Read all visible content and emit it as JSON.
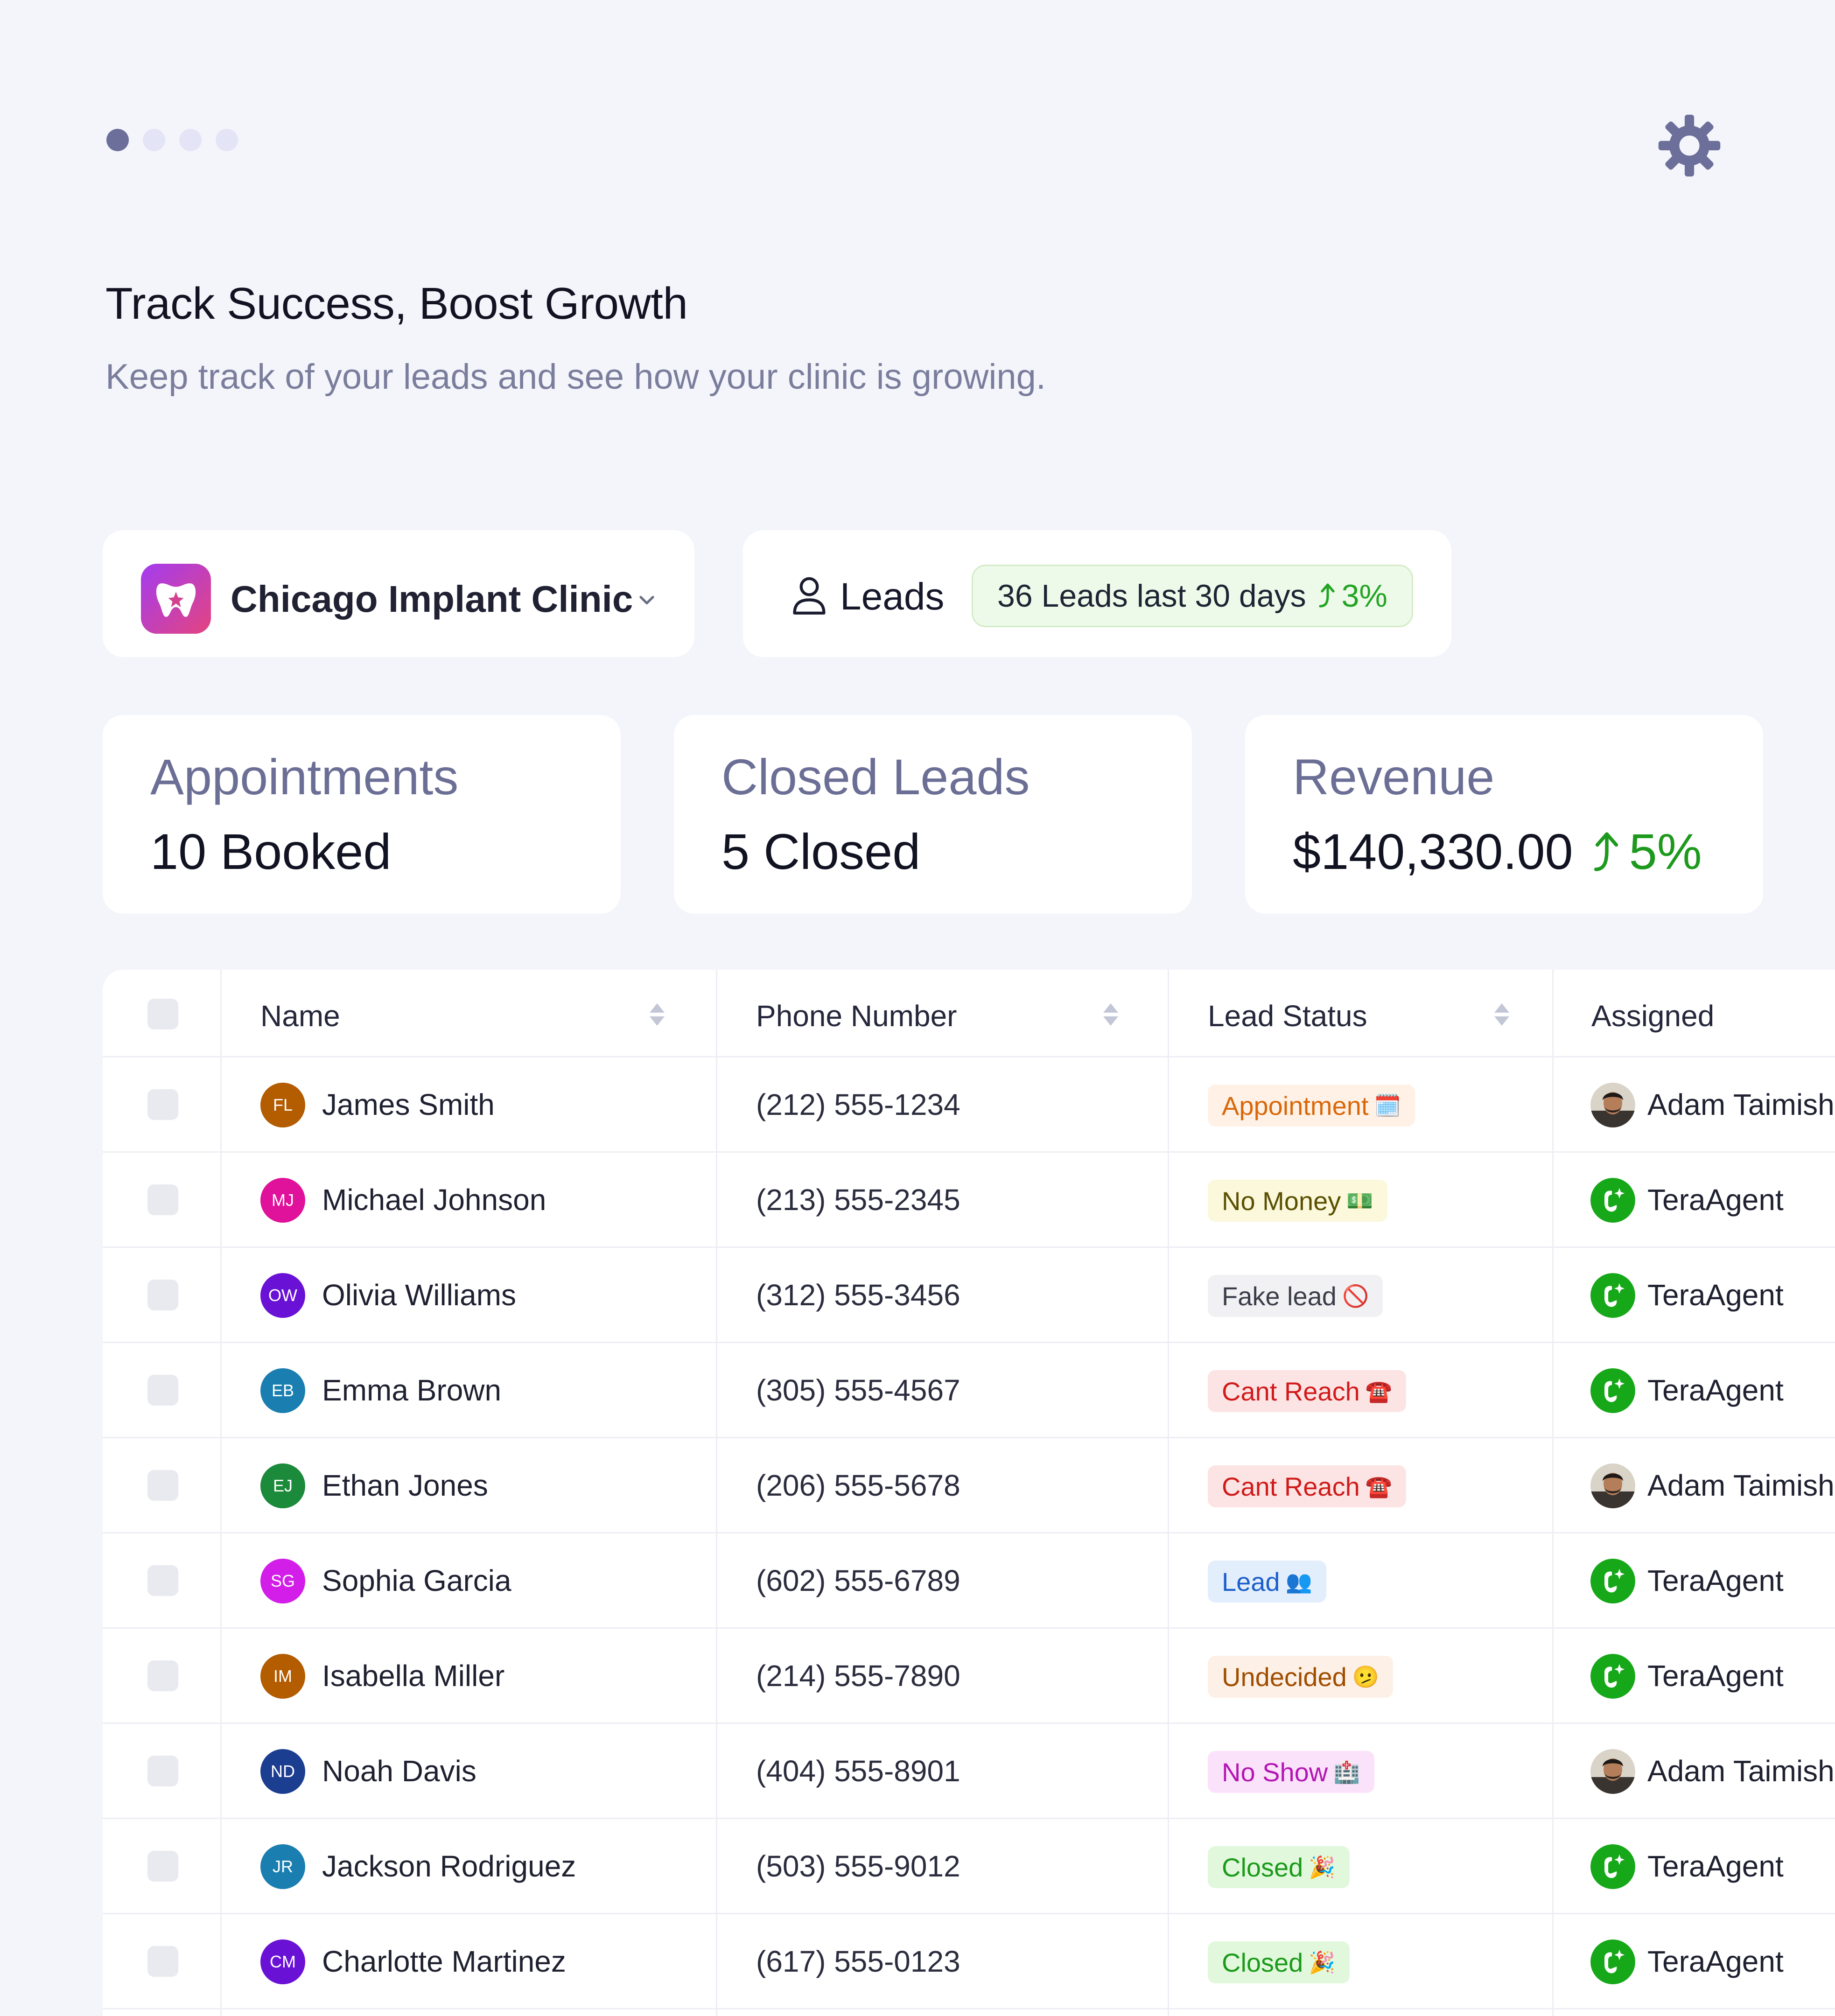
{
  "pager": {
    "dots": 4,
    "active": 0
  },
  "header": {
    "title": "Track Success, Boost Growth",
    "subtitle": "Keep track of your leads and see how your clinic is growing."
  },
  "clinic": {
    "name": "Chicago Implant Clinic"
  },
  "leads": {
    "label": "Leads",
    "summary": "36 Leads last 30 days",
    "change": "3%"
  },
  "stats": [
    {
      "label": "Appointments",
      "value": "10 Booked"
    },
    {
      "label": "Closed Leads",
      "value": "5 Closed"
    },
    {
      "label": "Revenue",
      "value": "$140,330.00",
      "change": "5%"
    }
  ],
  "table": {
    "columns": [
      "Name",
      "Phone Number",
      "Lead Status",
      "Assigned"
    ],
    "rows": [
      {
        "initials": "FL",
        "name": "James Smith",
        "phone": "(212) 555-1234",
        "status": "Appointment",
        "status_icon": "🗓️",
        "status_type": "appointment",
        "assigned": "Adam Taimish",
        "assigned_type": "person"
      },
      {
        "initials": "MJ",
        "name": "Michael Johnson",
        "phone": "(213) 555-2345",
        "status": "No Money",
        "status_icon": "💵",
        "status_type": "nomoney",
        "assigned": "TeraAgent",
        "assigned_type": "agent"
      },
      {
        "initials": "OW",
        "name": "Olivia Williams",
        "phone": "(312) 555-3456",
        "status": "Fake lead",
        "status_icon": "🚫",
        "status_type": "fake",
        "assigned": "TeraAgent",
        "assigned_type": "agent"
      },
      {
        "initials": "EB",
        "name": "Emma Brown",
        "phone": "(305) 555-4567",
        "status": "Cant Reach",
        "status_icon": "☎️",
        "status_type": "cantreach",
        "assigned": "TeraAgent",
        "assigned_type": "agent"
      },
      {
        "initials": "EJ",
        "name": "Ethan Jones",
        "phone": "(206) 555-5678",
        "status": "Cant Reach",
        "status_icon": "☎️",
        "status_type": "cantreach",
        "assigned": "Adam Taimish",
        "assigned_type": "person"
      },
      {
        "initials": "SG",
        "name": "Sophia Garcia",
        "phone": "(602) 555-6789",
        "status": "Lead",
        "status_icon": "👥",
        "status_type": "lead",
        "assigned": "TeraAgent",
        "assigned_type": "agent"
      },
      {
        "initials": "IM",
        "name": "Isabella Miller",
        "phone": "(214) 555-7890",
        "status": "Undecided",
        "status_icon": "🫤",
        "status_type": "undecided",
        "assigned": "TeraAgent",
        "assigned_type": "agent"
      },
      {
        "initials": "ND",
        "name": "Noah Davis",
        "phone": "(404) 555-8901",
        "status": "No Show",
        "status_icon": "🏥",
        "status_type": "noshow",
        "assigned": "Adam Taimish",
        "assigned_type": "person"
      },
      {
        "initials": "JR",
        "name": "Jackson Rodriguez",
        "phone": "(503) 555-9012",
        "status": "Closed",
        "status_icon": "🎉",
        "status_type": "closed",
        "assigned": "TeraAgent",
        "assigned_type": "agent"
      },
      {
        "initials": "CM",
        "name": "Charlotte Martinez",
        "phone": "(617) 555-0123",
        "status": "Closed",
        "status_icon": "🎉",
        "status_type": "closed",
        "assigned": "TeraAgent",
        "assigned_type": "agent"
      }
    ]
  },
  "colors": {
    "avatars": [
      "#b35c00",
      "#e0119a",
      "#6a11d6",
      "#1a7fb0",
      "#1b8a3a",
      "#d21ee8",
      "#b35c00",
      "#1c3e91",
      "#1a7fb0",
      "#6a11d6"
    ],
    "status": {
      "appointment": {
        "bg": "#fff1e6",
        "fg": "#d9680a"
      },
      "nomoney": {
        "bg": "#fbf8dc",
        "fg": "#5a5000"
      },
      "fake": {
        "bg": "#f1f1f3",
        "fg": "#3b3d4a"
      },
      "cantreach": {
        "bg": "#fde4e4",
        "fg": "#d11a1a"
      },
      "lead": {
        "bg": "#e3eefd",
        "fg": "#1c5fc9"
      },
      "undecided": {
        "bg": "#fdf0e6",
        "fg": "#a04d00"
      },
      "noshow": {
        "bg": "#fbe2fb",
        "fg": "#b316b3"
      },
      "closed": {
        "bg": "#e2f8dc",
        "fg": "#1a9a1a"
      }
    },
    "accent_green": "#23a424",
    "agent_green": "#17a81a"
  },
  "icons": {
    "settings": "gear-icon",
    "dropdown": "chevron-down-icon",
    "user": "user-icon",
    "trend": "trend-up-icon",
    "sort": "sort-icon"
  }
}
